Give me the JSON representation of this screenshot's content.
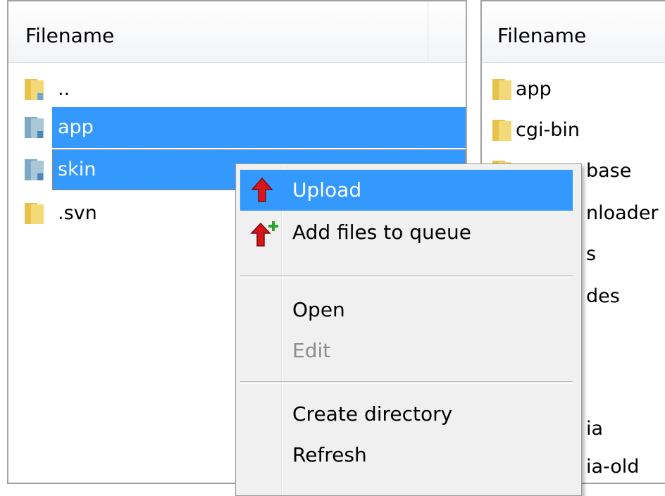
{
  "left_pane": {
    "header": "Filename",
    "rows": [
      {
        "name": "..",
        "selected": false
      },
      {
        "name": "app",
        "selected": true
      },
      {
        "name": "skin",
        "selected": true
      },
      {
        "name": ".svn",
        "selected": false
      }
    ]
  },
  "right_pane": {
    "header": "Filename",
    "rows": [
      {
        "name": "app"
      },
      {
        "name": "cgi-bin"
      },
      {
        "name": "base"
      },
      {
        "name": "nloader"
      },
      {
        "name": "s"
      },
      {
        "name": "des"
      },
      {
        "name": "ia"
      },
      {
        "name": "ia-old"
      }
    ]
  },
  "context_menu": {
    "items": [
      {
        "label": "Upload",
        "icon": "upload-arrow-icon",
        "highlighted": true,
        "enabled": true
      },
      {
        "label": "Add files to queue",
        "icon": "add-to-queue-icon",
        "enabled": true
      },
      {
        "label": "Open",
        "enabled": true
      },
      {
        "label": "Edit",
        "enabled": false
      },
      {
        "label": "Create directory",
        "enabled": true
      },
      {
        "label": "Refresh",
        "enabled": true
      }
    ]
  },
  "colors": {
    "selection": "#3399ff",
    "menu_background": "#f0f0f0",
    "disabled_text": "#8d8d8d"
  }
}
